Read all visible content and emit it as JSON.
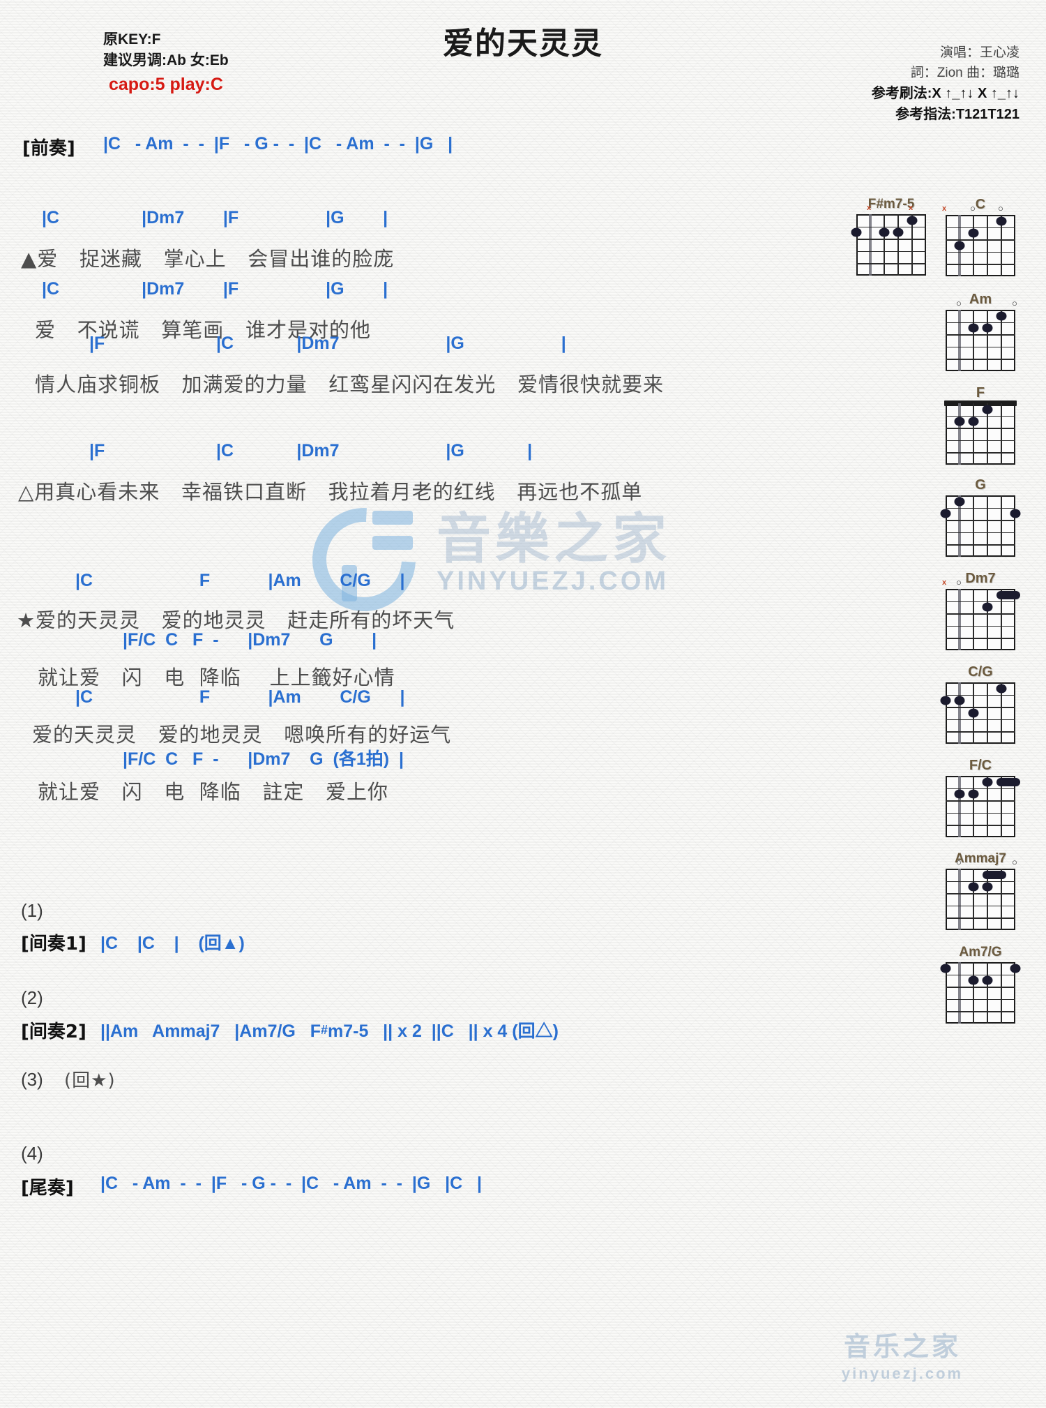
{
  "header": {
    "orig_key": "原KEY:F",
    "suggest_key": "建议男调:Ab 女:Eb",
    "capo": "capo:5 play:C",
    "title": "爱的天灵灵",
    "singer": "演唱：王心凌",
    "credits": "詞：Zion  曲：璐璐",
    "strum": "参考刷法:X ↑_↑↓ X ↑_↑↓",
    "fingerstyle": "参考指法:T121T121",
    "capo_color": "#d61a13",
    "chord_color": "#2a6fd0"
  },
  "intro": {
    "label": "[前奏]",
    "chords": "|C   - Am  -  -  |F   - G -  -  |C   - Am  -  -  |G   |"
  },
  "verse1": {
    "line1_chords": "|C                 |Dm7        |F                  |G        |",
    "line1_lyric": "▲爱   捉迷藏   掌心上   会冒出谁的脸庞",
    "line2_chords": "|C                 |Dm7        |F                  |G        |",
    "line2_lyric": "爱   不说谎   算笔画   谁才是对的他",
    "line3_chords": "|F                       |C             |Dm7                      |G                    |",
    "line3_lyric": "情人庙求铜板   加满爱的力量   红鸾星闪闪在发光   爱情很快就要来"
  },
  "verse2": {
    "line1_chords": "|F                       |C             |Dm7                      |G             |",
    "line1_lyric": "△用真心看未来   幸福铁口直断   我拉着月老的红线   再远也不孤单"
  },
  "chorus": {
    "line1_chords": "|C                      F            |Am        C/G      |",
    "line1_lyric": "★爱的天灵灵   爱的地灵灵   赶走所有的坏天气",
    "line2_chords": "|F/C  C   F  -      |Dm7      G        |",
    "line2_lyric": "就让爱   闪   电  降临    上上籤好心情",
    "line3_chords": "|C                      F            |Am        C/G      |",
    "line3_lyric": "爱的天灵灵   爱的地灵灵   嗯唤所有的好运气",
    "line4_chords": "|F/C  C   F  -      |Dm7    G  (各1拍)  |",
    "line4_lyric": "就让爱   闪   电  降临   註定   爱上你"
  },
  "endings": [
    {
      "num": "(1)",
      "label": "[间奏1]",
      "chords": "|C    |C    |    (回▲)"
    },
    {
      "num": "(2)",
      "label": "[间奏2]",
      "chords_pre": "||Am   Ammaj7   |Am7/G   F",
      "chords_sharp": "#",
      "chords_post": "m7-5   || x 2  ||C   || x 4 (回△)"
    },
    {
      "num": "(3)",
      "label": "",
      "chords": "(回★)"
    },
    {
      "num": "(4)",
      "label": "[尾奏]",
      "chords": "|C   - Am  -  -  |F   - G -  -  |C   - Am  -  -  |G   |C   |"
    }
  ],
  "chord_diagrams": [
    {
      "name": "F#m7-5",
      "markers": [
        "",
        "x",
        "",
        "",
        "x",
        ""
      ],
      "dots": [
        [
          2,
          1
        ],
        [
          2,
          3
        ],
        [
          2,
          4
        ],
        [
          1,
          5
        ]
      ],
      "barre": null,
      "nut": false
    },
    {
      "name": "C",
      "markers": [
        "x",
        "",
        "o",
        "",
        "o",
        ""
      ],
      "dots": [
        [
          3,
          2
        ],
        [
          2,
          3
        ],
        [
          1,
          5
        ]
      ],
      "barre": null,
      "nut": false
    },
    {
      "name": "Am",
      "markers": [
        "",
        "o",
        "",
        "",
        "",
        "o"
      ],
      "dots": [
        [
          2,
          3
        ],
        [
          2,
          4
        ],
        [
          1,
          5
        ]
      ],
      "barre": null,
      "nut": false
    },
    {
      "name": "F",
      "markers": [
        "",
        "",
        "",
        "",
        "",
        ""
      ],
      "dots": [
        [
          2,
          2
        ],
        [
          2,
          3
        ],
        [
          1,
          4
        ]
      ],
      "barre": null,
      "nut": true
    },
    {
      "name": "G",
      "markers": [
        "",
        "",
        "",
        "",
        "",
        ""
      ],
      "dots": [
        [
          1,
          2
        ],
        [
          2,
          1
        ],
        [
          2,
          6
        ]
      ],
      "barre": null,
      "nut": false
    },
    {
      "name": "Dm7",
      "markers": [
        "x",
        "o",
        "",
        "",
        "",
        ""
      ],
      "dots": [
        [
          2,
          4
        ]
      ],
      "barre": {
        "fret": 1,
        "from": 5,
        "to": 6
      },
      "nut": false
    },
    {
      "name": "C/G",
      "markers": [
        "",
        "",
        "",
        "",
        "",
        ""
      ],
      "dots": [
        [
          2,
          1
        ],
        [
          2,
          2
        ],
        [
          3,
          3
        ],
        [
          1,
          5
        ]
      ],
      "barre": null,
      "nut": false
    },
    {
      "name": "F/C",
      "markers": [
        "",
        "",
        "",
        "",
        "",
        ""
      ],
      "dots": [
        [
          2,
          2
        ],
        [
          2,
          3
        ],
        [
          1,
          4
        ]
      ],
      "barre": {
        "fret": 1,
        "from": 5,
        "to": 6
      },
      "nut": false
    },
    {
      "name": "Ammaj7",
      "markers": [
        "",
        "o",
        "",
        "",
        "",
        "o"
      ],
      "dots": [
        [
          2,
          3
        ],
        [
          2,
          4
        ]
      ],
      "barre": {
        "fret": 1,
        "from": 4,
        "to": 5
      },
      "nut": false
    },
    {
      "name": "Am7/G",
      "markers": [
        "",
        "",
        "",
        "",
        "",
        ""
      ],
      "dots": [
        [
          1,
          1
        ],
        [
          2,
          3
        ],
        [
          2,
          4
        ],
        [
          1,
          6
        ]
      ],
      "barre": null,
      "nut": false
    }
  ],
  "watermarks": {
    "main_text": "音樂之家",
    "main_sub": "YINYUEZJ.COM",
    "corner_text": "音乐之家",
    "corner_sub": "yinyuezj.com"
  }
}
